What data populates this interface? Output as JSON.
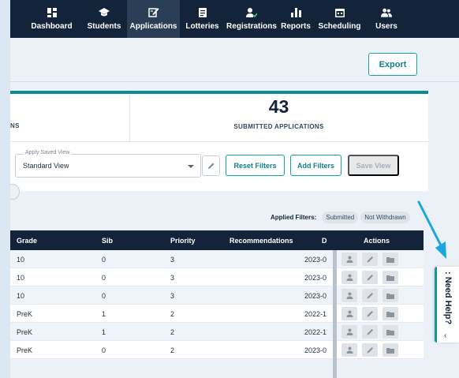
{
  "nav": {
    "items": [
      {
        "label": "Dashboard",
        "icon": "dashboard-icon"
      },
      {
        "label": "Students",
        "icon": "graduation-cap-icon"
      },
      {
        "label": "Applications",
        "icon": "edit-document-icon",
        "active": true
      },
      {
        "label": "Lotteries",
        "icon": "clipboard-icon"
      },
      {
        "label": "Registrations",
        "icon": "user-check-icon"
      },
      {
        "label": "Reports",
        "icon": "bar-chart-icon"
      },
      {
        "label": "Scheduling",
        "icon": "calendar-icon"
      },
      {
        "label": "Users",
        "icon": "users-icon"
      }
    ]
  },
  "header": {
    "export_label": "Export"
  },
  "stats": {
    "left_label": "NS",
    "submitted_count": "43",
    "submitted_label": "SUBMITTED APPLICATIONS"
  },
  "filters": {
    "saved_view_legend": "Apply Saved View",
    "saved_view_value": "Standard View",
    "reset_label": "Reset Filters",
    "add_label": "Add Filters",
    "save_view_label": "Save View"
  },
  "applied": {
    "label": "Applied Filters:",
    "chips": [
      "Submitted",
      "Not Withdrawn"
    ]
  },
  "table": {
    "headers": [
      "Grade",
      "Sib",
      "Priority",
      "Recommendations",
      "D",
      "Actions"
    ],
    "rows": [
      {
        "grade": "10",
        "sib": "0",
        "priority": "3",
        "date": "2023-0"
      },
      {
        "grade": "10",
        "sib": "0",
        "priority": "3",
        "date": "2023-0"
      },
      {
        "grade": "10",
        "sib": "0",
        "priority": "3",
        "date": "2023-0"
      },
      {
        "grade": "PreK",
        "sib": "1",
        "priority": "2",
        "date": "2022-1"
      },
      {
        "grade": "PreK",
        "sib": "1",
        "priority": "2",
        "date": "2022-1"
      },
      {
        "grade": "PreK",
        "sib": "0",
        "priority": "2",
        "date": "2023-0"
      }
    ]
  },
  "help": {
    "label": ": Need Help?",
    "chevron": "‹"
  },
  "colors": {
    "nav_bg": "#13243a",
    "accent": "#11989a",
    "annotation_arrow": "#1aa6e0"
  }
}
